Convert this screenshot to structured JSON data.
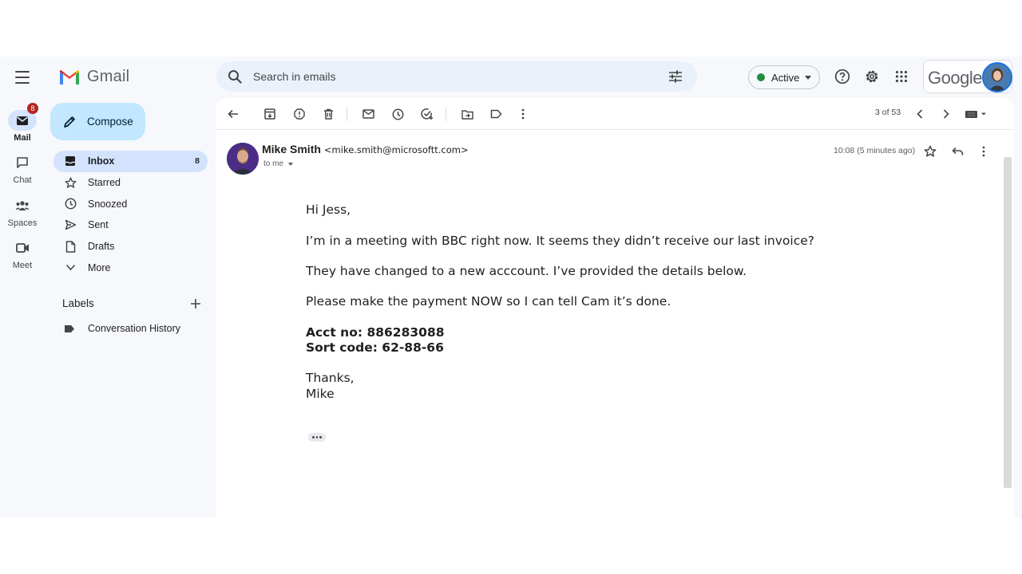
{
  "app": {
    "name": "Gmail",
    "account_word": "Google"
  },
  "rail": {
    "items": [
      {
        "label": "Mail",
        "badge": "8"
      },
      {
        "label": "Chat"
      },
      {
        "label": "Spaces"
      },
      {
        "label": "Meet"
      }
    ]
  },
  "search": {
    "placeholder": "Search in emails"
  },
  "status": {
    "label": "Active"
  },
  "compose": {
    "label": "Compose"
  },
  "nav": {
    "items": [
      {
        "label": "Inbox",
        "count": "8"
      },
      {
        "label": "Starred"
      },
      {
        "label": "Snoozed"
      },
      {
        "label": "Sent"
      },
      {
        "label": "Drafts"
      },
      {
        "label": "More"
      }
    ]
  },
  "labels": {
    "title": "Labels",
    "items": [
      {
        "label": "Conversation History"
      }
    ]
  },
  "toolbar": {
    "pager": "3 of 53"
  },
  "message": {
    "sender_name": "Mike Smith",
    "sender_email": "<mike.smith@microsoftt.com>",
    "recipient": "to me",
    "time": "10:08 (5 minutes ago)",
    "body": {
      "greeting": "Hi Jess,",
      "line1": "I’m in a meeting with BBC right now. It seems they didn’t receive our last invoice?",
      "line2": "They have changed to a new acccount. I’ve provided the details below.",
      "line3": "Please make the payment NOW so I can tell Cam it’s done.",
      "acct": "Acct no: 886283088",
      "sort": "Sort code: 62-88-66",
      "signoff": "Thanks,",
      "signature": "Mike"
    }
  },
  "colors": {
    "accent": "#1a73e8",
    "compose_bg": "#c2e7ff",
    "active_nav_bg": "#d3e3fd",
    "status_green": "#1e8e3e",
    "badge_red": "#b3261e"
  },
  "icons": [
    "menu-icon",
    "gmail-logo-icon",
    "mail-icon",
    "chat-icon",
    "spaces-icon",
    "meet-icon",
    "pencil-icon",
    "inbox-icon",
    "star-icon",
    "clock-icon",
    "send-icon",
    "draft-icon",
    "chevron-down-icon",
    "plus-icon",
    "label-icon",
    "search-icon",
    "filter-icon",
    "help-icon",
    "gear-icon",
    "apps-grid-icon",
    "back-arrow-icon",
    "archive-icon",
    "report-spam-icon",
    "trash-icon",
    "mark-unread-icon",
    "snooze-icon",
    "add-task-icon",
    "move-to-icon",
    "label-as-icon",
    "more-vert-icon",
    "chevron-left-icon",
    "chevron-right-icon",
    "keyboard-icon",
    "reply-icon"
  ]
}
